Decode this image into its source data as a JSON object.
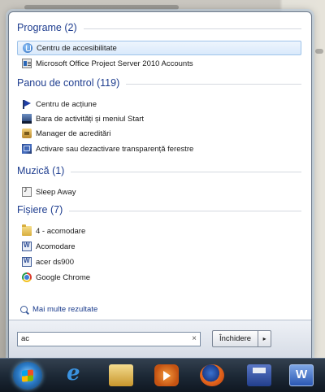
{
  "sections": {
    "programs": {
      "header": "Programe (2)",
      "items": [
        {
          "label": "Centru de accesibilitate",
          "icon": "accessibility-icon",
          "selected": true
        },
        {
          "label": "Microsoft Office Project Server 2010 Accounts",
          "icon": "office-project-icon"
        }
      ]
    },
    "control_panel": {
      "header": "Panou de control (119)",
      "items": [
        {
          "label": "Centru de acțiune",
          "icon": "action-center-flag-icon"
        },
        {
          "label": "Bara de activități și meniul Start",
          "icon": "taskbar-icon"
        },
        {
          "label": "Manager de acreditări",
          "icon": "credential-manager-icon"
        },
        {
          "label": "Activare sau dezactivare transparență ferestre",
          "icon": "window-transparency-icon"
        }
      ]
    },
    "music": {
      "header": "Muzică (1)",
      "items": [
        {
          "label": "Sleep Away",
          "icon": "music-file-icon"
        }
      ]
    },
    "files": {
      "header": "Fișiere (7)",
      "items": [
        {
          "label": "4 - acomodare",
          "icon": "folder-icon"
        },
        {
          "label": "Acomodare",
          "icon": "document-icon"
        },
        {
          "label": "acer ds900",
          "icon": "document-icon"
        },
        {
          "label": "Google Chrome",
          "icon": "chrome-icon"
        }
      ]
    }
  },
  "more_results": "Mai multe rezultate",
  "search": {
    "value": "ac",
    "clear_glyph": "×"
  },
  "shutdown": {
    "label": "Închidere",
    "arrow": "▸"
  },
  "taskbar": {
    "buttons": [
      "start-orb-icon",
      "internet-explorer-icon",
      "windows-explorer-icon",
      "media-player-icon",
      "firefox-icon",
      "save-disk-icon",
      "word-icon"
    ]
  },
  "colors": {
    "header_text": "#1e3d8f",
    "selection": "#d9e9fb",
    "taskbar": "#1b2734"
  }
}
